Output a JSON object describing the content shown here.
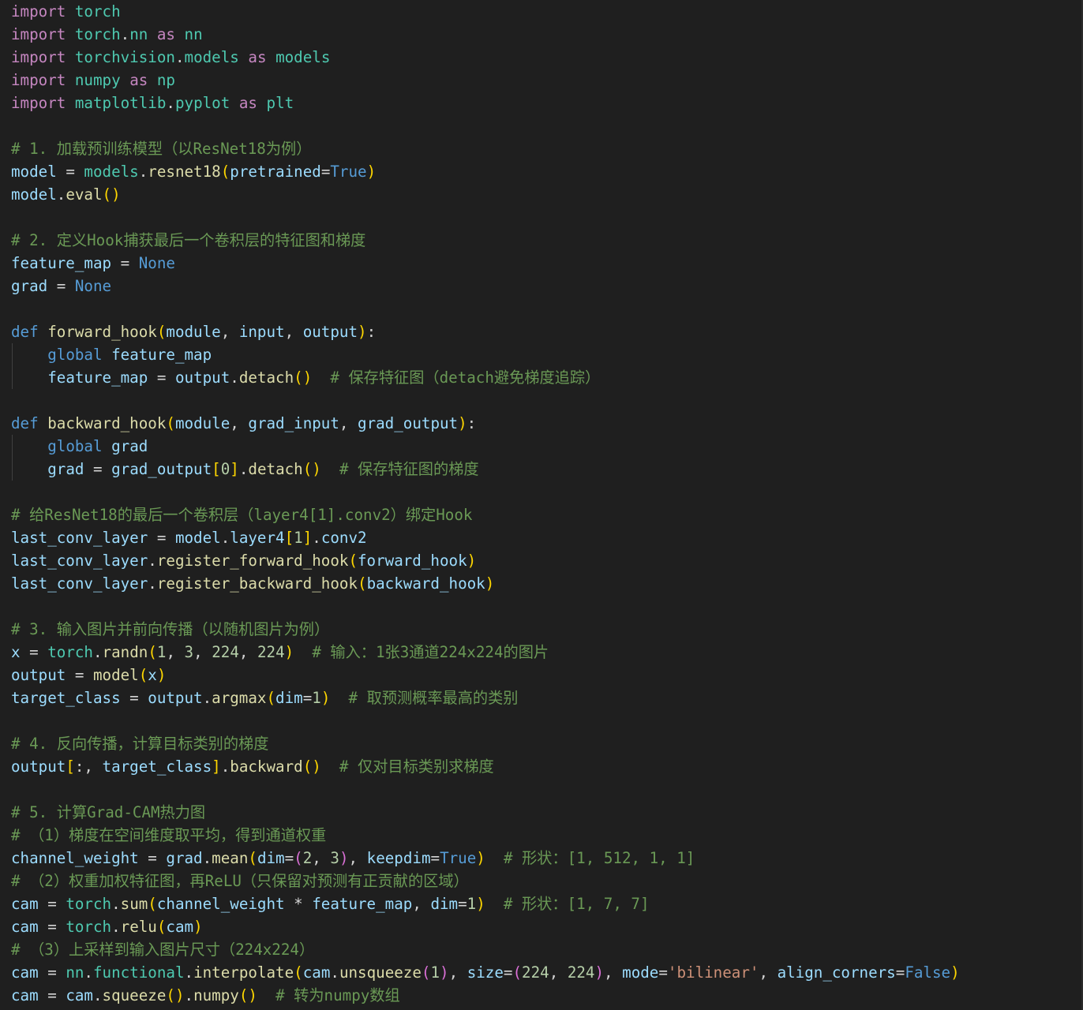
{
  "editor": {
    "language": "python",
    "lines": [
      [
        [
          "kw",
          "import"
        ],
        [
          "id",
          " "
        ],
        [
          "mod",
          "torch"
        ]
      ],
      [
        [
          "kw",
          "import"
        ],
        [
          "id",
          " "
        ],
        [
          "mod",
          "torch"
        ],
        [
          "id",
          "."
        ],
        [
          "mod",
          "nn"
        ],
        [
          "id",
          " "
        ],
        [
          "kw",
          "as"
        ],
        [
          "id",
          " "
        ],
        [
          "mod",
          "nn"
        ]
      ],
      [
        [
          "kw",
          "import"
        ],
        [
          "id",
          " "
        ],
        [
          "mod",
          "torchvision"
        ],
        [
          "id",
          "."
        ],
        [
          "mod",
          "models"
        ],
        [
          "id",
          " "
        ],
        [
          "kw",
          "as"
        ],
        [
          "id",
          " "
        ],
        [
          "mod",
          "models"
        ]
      ],
      [
        [
          "kw",
          "import"
        ],
        [
          "id",
          " "
        ],
        [
          "mod",
          "numpy"
        ],
        [
          "id",
          " "
        ],
        [
          "kw",
          "as"
        ],
        [
          "id",
          " "
        ],
        [
          "mod",
          "np"
        ]
      ],
      [
        [
          "kw",
          "import"
        ],
        [
          "id",
          " "
        ],
        [
          "mod",
          "matplotlib"
        ],
        [
          "id",
          "."
        ],
        [
          "mod",
          "pyplot"
        ],
        [
          "id",
          " "
        ],
        [
          "kw",
          "as"
        ],
        [
          "id",
          " "
        ],
        [
          "mod",
          "plt"
        ]
      ],
      [],
      [
        [
          "cm",
          "# 1. 加载预训练模型（以ResNet18为例）"
        ]
      ],
      [
        [
          "var",
          "model"
        ],
        [
          "op",
          " = "
        ],
        [
          "mod",
          "models"
        ],
        [
          "id",
          "."
        ],
        [
          "fn",
          "resnet18"
        ],
        [
          "b1",
          "("
        ],
        [
          "par",
          "pretrained"
        ],
        [
          "op",
          "="
        ],
        [
          "cnst",
          "True"
        ],
        [
          "b1",
          ")"
        ]
      ],
      [
        [
          "var",
          "model"
        ],
        [
          "id",
          "."
        ],
        [
          "fn",
          "eval"
        ],
        [
          "b1",
          "()"
        ]
      ],
      [],
      [
        [
          "cm",
          "# 2. 定义Hook捕获最后一个卷积层的特征图和梯度"
        ]
      ],
      [
        [
          "var",
          "feature_map"
        ],
        [
          "op",
          " = "
        ],
        [
          "cnst",
          "None"
        ]
      ],
      [
        [
          "var",
          "grad"
        ],
        [
          "op",
          " = "
        ],
        [
          "cnst",
          "None"
        ]
      ],
      [],
      [
        [
          "dkw",
          "def"
        ],
        [
          "id",
          " "
        ],
        [
          "fn",
          "forward_hook"
        ],
        [
          "b1",
          "("
        ],
        [
          "par",
          "module"
        ],
        [
          "id",
          ", "
        ],
        [
          "par",
          "input"
        ],
        [
          "id",
          ", "
        ],
        [
          "var",
          "output"
        ],
        [
          "b1",
          ")"
        ],
        [
          "id",
          ":"
        ]
      ],
      [
        [
          "id",
          "    "
        ],
        [
          "dkw",
          "global"
        ],
        [
          "id",
          " "
        ],
        [
          "var",
          "feature_map"
        ]
      ],
      [
        [
          "id",
          "    "
        ],
        [
          "var",
          "feature_map"
        ],
        [
          "op",
          " = "
        ],
        [
          "var",
          "output"
        ],
        [
          "id",
          "."
        ],
        [
          "fn",
          "detach"
        ],
        [
          "b1",
          "()"
        ],
        [
          "id",
          "  "
        ],
        [
          "cm",
          "# 保存特征图（detach避免梯度追踪）"
        ]
      ],
      [],
      [
        [
          "dkw",
          "def"
        ],
        [
          "id",
          " "
        ],
        [
          "fn",
          "backward_hook"
        ],
        [
          "b1",
          "("
        ],
        [
          "par",
          "module"
        ],
        [
          "id",
          ", "
        ],
        [
          "par",
          "grad_input"
        ],
        [
          "id",
          ", "
        ],
        [
          "var",
          "grad_output"
        ],
        [
          "b1",
          ")"
        ],
        [
          "id",
          ":"
        ]
      ],
      [
        [
          "id",
          "    "
        ],
        [
          "dkw",
          "global"
        ],
        [
          "id",
          " "
        ],
        [
          "var",
          "grad"
        ]
      ],
      [
        [
          "id",
          "    "
        ],
        [
          "var",
          "grad"
        ],
        [
          "op",
          " = "
        ],
        [
          "var",
          "grad_output"
        ],
        [
          "b1",
          "["
        ],
        [
          "num",
          "0"
        ],
        [
          "b1",
          "]"
        ],
        [
          "id",
          "."
        ],
        [
          "fn",
          "detach"
        ],
        [
          "b1",
          "()"
        ],
        [
          "id",
          "  "
        ],
        [
          "cm",
          "# 保存特征图的梯度"
        ]
      ],
      [],
      [
        [
          "cm",
          "# 给ResNet18的最后一个卷积层（layer4[1].conv2）绑定Hook"
        ]
      ],
      [
        [
          "var",
          "last_conv_layer"
        ],
        [
          "op",
          " = "
        ],
        [
          "var",
          "model"
        ],
        [
          "id",
          "."
        ],
        [
          "var",
          "layer4"
        ],
        [
          "b1",
          "["
        ],
        [
          "num",
          "1"
        ],
        [
          "b1",
          "]"
        ],
        [
          "id",
          "."
        ],
        [
          "var",
          "conv2"
        ]
      ],
      [
        [
          "var",
          "last_conv_layer"
        ],
        [
          "id",
          "."
        ],
        [
          "fn",
          "register_forward_hook"
        ],
        [
          "b1",
          "("
        ],
        [
          "var",
          "forward_hook"
        ],
        [
          "b1",
          ")"
        ]
      ],
      [
        [
          "var",
          "last_conv_layer"
        ],
        [
          "id",
          "."
        ],
        [
          "fn",
          "register_backward_hook"
        ],
        [
          "b1",
          "("
        ],
        [
          "var",
          "backward_hook"
        ],
        [
          "b1",
          ")"
        ]
      ],
      [],
      [
        [
          "cm",
          "# 3. 输入图片并前向传播（以随机图片为例）"
        ]
      ],
      [
        [
          "var",
          "x"
        ],
        [
          "op",
          " = "
        ],
        [
          "mod",
          "torch"
        ],
        [
          "id",
          "."
        ],
        [
          "fn",
          "randn"
        ],
        [
          "b1",
          "("
        ],
        [
          "num",
          "1"
        ],
        [
          "id",
          ", "
        ],
        [
          "num",
          "3"
        ],
        [
          "id",
          ", "
        ],
        [
          "num",
          "224"
        ],
        [
          "id",
          ", "
        ],
        [
          "num",
          "224"
        ],
        [
          "b1",
          ")"
        ],
        [
          "id",
          "  "
        ],
        [
          "cm",
          "# 输入：1张3通道224x224的图片"
        ]
      ],
      [
        [
          "var",
          "output"
        ],
        [
          "op",
          " = "
        ],
        [
          "fn",
          "model"
        ],
        [
          "b1",
          "("
        ],
        [
          "var",
          "x"
        ],
        [
          "b1",
          ")"
        ]
      ],
      [
        [
          "var",
          "target_class"
        ],
        [
          "op",
          " = "
        ],
        [
          "var",
          "output"
        ],
        [
          "id",
          "."
        ],
        [
          "fn",
          "argmax"
        ],
        [
          "b1",
          "("
        ],
        [
          "par",
          "dim"
        ],
        [
          "op",
          "="
        ],
        [
          "num",
          "1"
        ],
        [
          "b1",
          ")"
        ],
        [
          "id",
          "  "
        ],
        [
          "cm",
          "# 取预测概率最高的类别"
        ]
      ],
      [],
      [
        [
          "cm",
          "# 4. 反向传播，计算目标类别的梯度"
        ]
      ],
      [
        [
          "var",
          "output"
        ],
        [
          "b1",
          "["
        ],
        [
          "id",
          ":, "
        ],
        [
          "var",
          "target_class"
        ],
        [
          "b1",
          "]"
        ],
        [
          "id",
          "."
        ],
        [
          "fn",
          "backward"
        ],
        [
          "b1",
          "()"
        ],
        [
          "id",
          "  "
        ],
        [
          "cm",
          "# 仅对目标类别求梯度"
        ]
      ],
      [],
      [
        [
          "cm",
          "# 5. 计算Grad-CAM热力图"
        ]
      ],
      [
        [
          "cm",
          "# （1）梯度在空间维度取平均，得到通道权重"
        ]
      ],
      [
        [
          "var",
          "channel_weight"
        ],
        [
          "op",
          " = "
        ],
        [
          "var",
          "grad"
        ],
        [
          "id",
          "."
        ],
        [
          "fn",
          "mean"
        ],
        [
          "b1",
          "("
        ],
        [
          "par",
          "dim"
        ],
        [
          "op",
          "="
        ],
        [
          "b2",
          "("
        ],
        [
          "num",
          "2"
        ],
        [
          "id",
          ", "
        ],
        [
          "num",
          "3"
        ],
        [
          "b2",
          ")"
        ],
        [
          "id",
          ", "
        ],
        [
          "par",
          "keepdim"
        ],
        [
          "op",
          "="
        ],
        [
          "cnst",
          "True"
        ],
        [
          "b1",
          ")"
        ],
        [
          "id",
          "  "
        ],
        [
          "cm",
          "# 形状：[1, 512, 1, 1]"
        ]
      ],
      [
        [
          "cm",
          "# （2）权重加权特征图，再ReLU（只保留对预测有正贡献的区域）"
        ]
      ],
      [
        [
          "var",
          "cam"
        ],
        [
          "op",
          " = "
        ],
        [
          "mod",
          "torch"
        ],
        [
          "id",
          "."
        ],
        [
          "fn",
          "sum"
        ],
        [
          "b1",
          "("
        ],
        [
          "var",
          "channel_weight"
        ],
        [
          "op",
          " * "
        ],
        [
          "var",
          "feature_map"
        ],
        [
          "id",
          ", "
        ],
        [
          "par",
          "dim"
        ],
        [
          "op",
          "="
        ],
        [
          "num",
          "1"
        ],
        [
          "b1",
          ")"
        ],
        [
          "id",
          "  "
        ],
        [
          "cm",
          "# 形状：[1, 7, 7]"
        ]
      ],
      [
        [
          "var",
          "cam"
        ],
        [
          "op",
          " = "
        ],
        [
          "mod",
          "torch"
        ],
        [
          "id",
          "."
        ],
        [
          "fn",
          "relu"
        ],
        [
          "b1",
          "("
        ],
        [
          "var",
          "cam"
        ],
        [
          "b1",
          ")"
        ]
      ],
      [
        [
          "cm",
          "# （3）上采样到输入图片尺寸（224x224）"
        ]
      ],
      [
        [
          "var",
          "cam"
        ],
        [
          "op",
          " = "
        ],
        [
          "mod",
          "nn"
        ],
        [
          "id",
          "."
        ],
        [
          "mod",
          "functional"
        ],
        [
          "id",
          "."
        ],
        [
          "fn",
          "interpolate"
        ],
        [
          "b1",
          "("
        ],
        [
          "var",
          "cam"
        ],
        [
          "id",
          "."
        ],
        [
          "fn",
          "unsqueeze"
        ],
        [
          "b2",
          "("
        ],
        [
          "num",
          "1"
        ],
        [
          "b2",
          ")"
        ],
        [
          "id",
          ", "
        ],
        [
          "par",
          "size"
        ],
        [
          "op",
          "="
        ],
        [
          "b2",
          "("
        ],
        [
          "num",
          "224"
        ],
        [
          "id",
          ", "
        ],
        [
          "num",
          "224"
        ],
        [
          "b2",
          ")"
        ],
        [
          "id",
          ", "
        ],
        [
          "par",
          "mode"
        ],
        [
          "op",
          "="
        ],
        [
          "str",
          "'bilinear'"
        ],
        [
          "id",
          ", "
        ],
        [
          "par",
          "align_corners"
        ],
        [
          "op",
          "="
        ],
        [
          "cnst",
          "False"
        ],
        [
          "b1",
          ")"
        ]
      ],
      [
        [
          "var",
          "cam"
        ],
        [
          "op",
          " = "
        ],
        [
          "var",
          "cam"
        ],
        [
          "id",
          "."
        ],
        [
          "fn",
          "squeeze"
        ],
        [
          "b1",
          "()"
        ],
        [
          "id",
          "."
        ],
        [
          "fn",
          "numpy"
        ],
        [
          "b1",
          "()"
        ],
        [
          "id",
          "  "
        ],
        [
          "cm",
          "# 转为numpy数组"
        ]
      ]
    ]
  }
}
